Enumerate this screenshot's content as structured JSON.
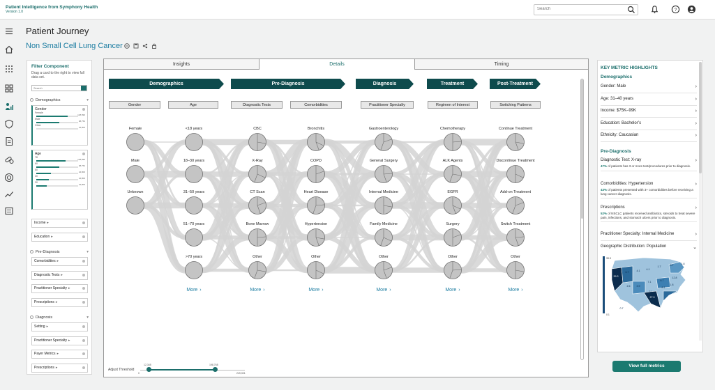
{
  "app": {
    "brand": "Patient Intelligence from Symphony Health",
    "version": "Version 1.0"
  },
  "search": {
    "placeholder": "Search"
  },
  "page": {
    "title": "Patient Journey",
    "subtitle": "Non Small Cell Lung Cancer"
  },
  "filter": {
    "title": "Filter Component",
    "description": "Drag a card to the right to view full data set.",
    "search_placeholder": "Search",
    "sections": [
      {
        "label": "Demographics"
      },
      {
        "label": "Pre-Diagnosis"
      },
      {
        "label": "Diagnosis"
      }
    ],
    "gender_card": {
      "label": "Gender",
      "rows": [
        {
          "label": "Female",
          "count": "128,890",
          "fraction": 0.75
        },
        {
          "label": "Male",
          "count": "98,752",
          "fraction": 0.55
        },
        {
          "label": "Other",
          "count": "24,800",
          "fraction": 0.0
        }
      ]
    },
    "age_card": {
      "label": "Age",
      "rows": [
        {
          "label": "78",
          "count": "128,890",
          "fraction": 0.7
        },
        {
          "label": "60",
          "count": "98,752",
          "fraction": 0.55
        },
        {
          "label": "50",
          "count": "24,800",
          "fraction": 0.35
        },
        {
          "label": "40",
          "count": "24,800",
          "fraction": 0.3
        },
        {
          "label": "30",
          "count": "24,800",
          "fraction": 0.25
        }
      ]
    },
    "demo_cards": [
      "Income",
      "Education"
    ],
    "prediag_cards": [
      "Comorbidities",
      "Diagnostic Tests",
      "Practitioner Specialty",
      "Prescriptions"
    ],
    "diag_cards": [
      "Setting",
      "Practitioner Specialty",
      "Payer Metrics",
      "Prescriptions"
    ]
  },
  "tabs": [
    {
      "label": "Insights"
    },
    {
      "label": "Details"
    },
    {
      "label": "Timing"
    }
  ],
  "stages": [
    "Demographics",
    "Pre-Diagnosis",
    "Diagnosis",
    "Treatment",
    "Post-Treatment"
  ],
  "subheaders": [
    "Gender",
    "Age",
    "Diagnostic Tests",
    "Comorbidities",
    "Practitioner Specialty",
    "Regimen of Interest",
    "Switching Patterns"
  ],
  "columns": [
    {
      "key": "gender",
      "nodes": [
        "Female",
        "Male",
        "Unknown"
      ]
    },
    {
      "key": "age",
      "nodes": [
        "<18 years",
        "18–30 years",
        "31–50 years",
        "51–70 years",
        ">70 years"
      ]
    },
    {
      "key": "tests",
      "nodes": [
        "CBC",
        "X-Ray",
        "CT Scan",
        "Bone Marrow",
        "Other"
      ]
    },
    {
      "key": "comorb",
      "nodes": [
        "Bronchitis",
        "COPD",
        "Heart Disease",
        "Hypertension",
        "Other"
      ]
    },
    {
      "key": "spec",
      "nodes": [
        "Gastroenterology",
        "General Surgery",
        "Internal Medicine",
        "Family Medicine",
        "Other"
      ]
    },
    {
      "key": "regimen",
      "nodes": [
        "Chemotherapy",
        "ALK Agents",
        "EGFR",
        "Surgery",
        "Other"
      ]
    },
    {
      "key": "switch",
      "nodes": [
        "Continue Treatment",
        "Discontinue Treatment",
        "Add-on Treatment",
        "Switch Treatment",
        "Other"
      ]
    }
  ],
  "more_label": "More",
  "threshold": {
    "label": "Adjust Threshold",
    "min": "0",
    "low": "12,345",
    "high": "198,765",
    "max": "249,301"
  },
  "metrics": {
    "title": "KEY METRIC HIGHLIGHTS",
    "demographics_label": "Demographics",
    "demographics": [
      "Gender: Male",
      "Age: 31–40 years",
      "Income: $75K–99K",
      "Education: Bachelor’s",
      "Ethnicity: Caucasian"
    ],
    "prediag_label": "Pre-Diagnosis",
    "prediag": [
      {
        "label": "Diagnostic Test: X-ray",
        "pct": "47%",
        "desc": "of patients has 3 or more test/procedures prior to diagnosis."
      },
      {
        "label": "Comorbidities: Hypertension",
        "pct": "43%",
        "desc": "of patients presented with 3+ comorbidities before receiving a lung cancer diagnosis."
      },
      {
        "label": "Prescriptions",
        "pct": "52%",
        "desc": "of NSCLC patients received antibiotics, steroids to treat severe pain, infections, and stomach ulcers prior to diagnosis."
      }
    ],
    "practitioner": "Practitioner Specialty: Internal Medicine",
    "geo": "Geographic Distribution: Population",
    "map_values": [
      "39.3",
      "6.7",
      "4.1",
      "4.1",
      "1.7",
      "3.7",
      "1.8",
      "2.6",
      "3.9",
      "7.1",
      "6.7",
      "12.8",
      "8.1",
      "3.1",
      "1.8",
      "27.9",
      "0.7"
    ],
    "map_legend": [
      "39.3",
      "0.1"
    ]
  },
  "view_full": "View full metrics",
  "colors": {
    "accent": "#1b6e6b",
    "stage": "#0e4b4d",
    "link": "#1b7ca1"
  }
}
